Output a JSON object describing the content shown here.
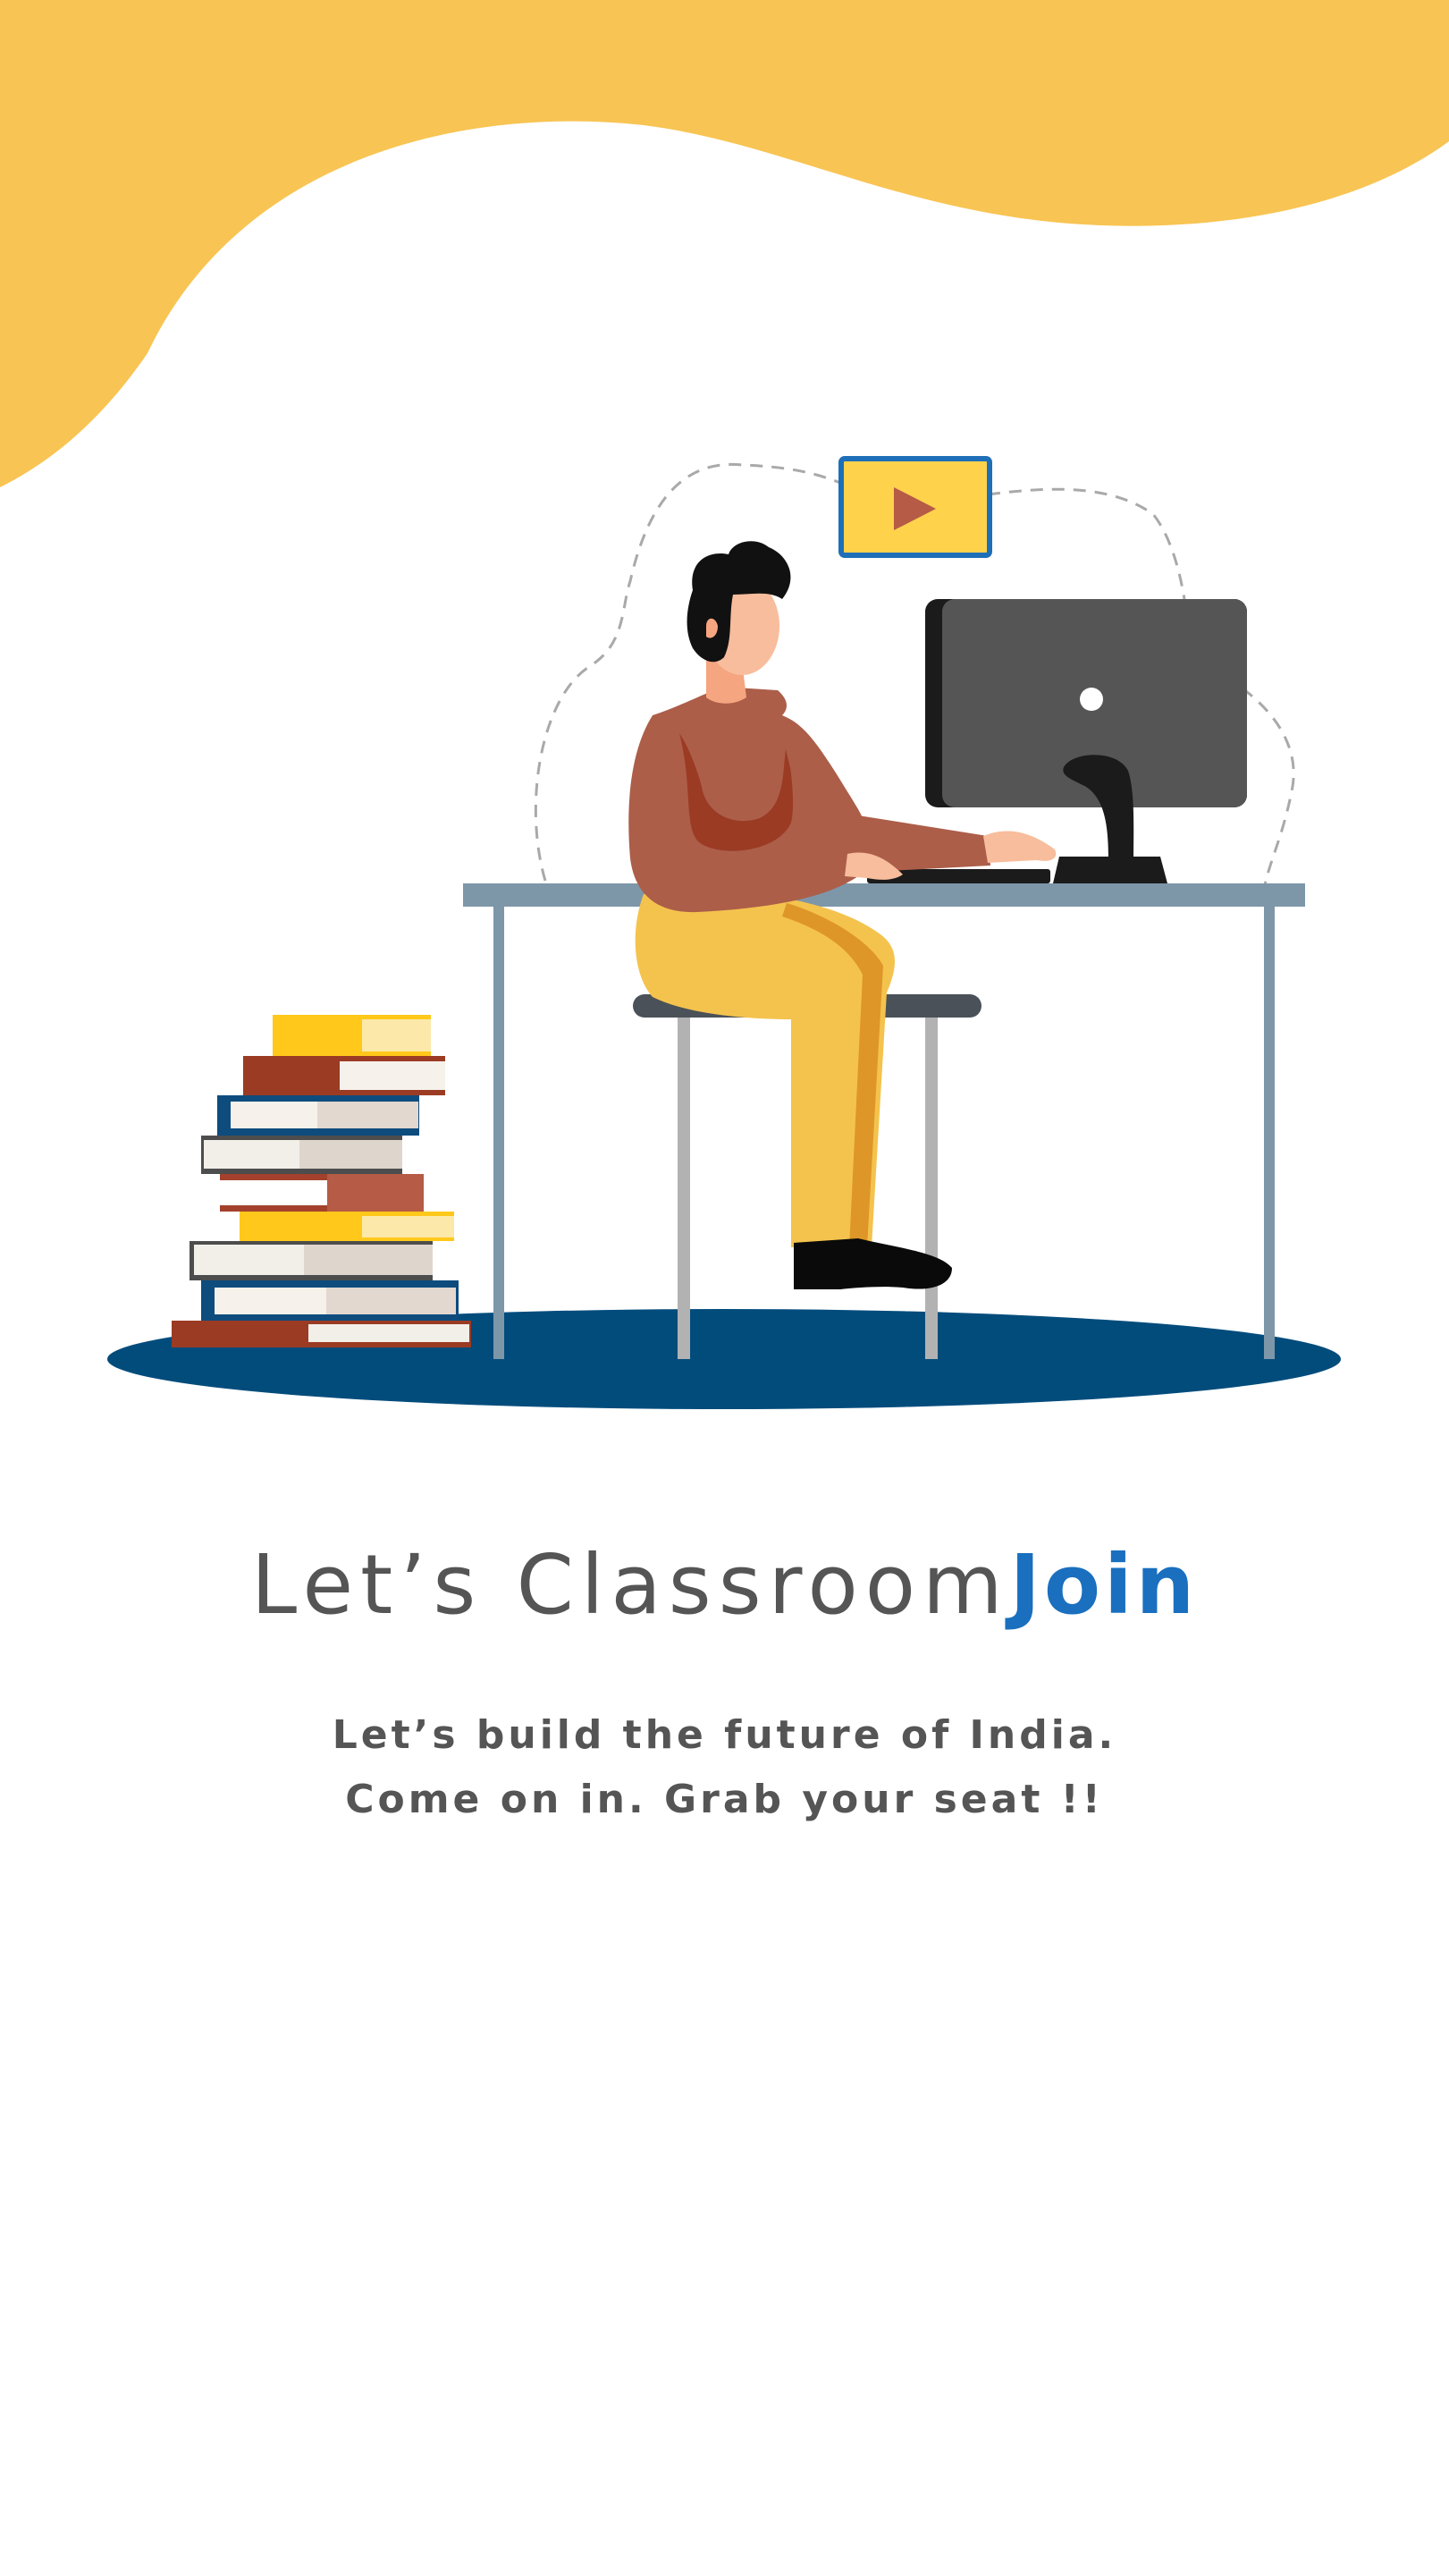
{
  "onboarding": {
    "title_prefix": "Let’s Classroom",
    "title_accent": "Join",
    "subtitle_line1": "Let’s build the future of India.",
    "subtitle_line2": "Come on in. Grab your seat !!"
  },
  "illustration": {
    "name": "student-at-computer-illustration",
    "icons": [
      "video-play-icon",
      "computer-monitor-icon",
      "book-stack-icon"
    ]
  },
  "colors": {
    "wave_yellow": "#F8C453",
    "accent_blue": "#1A6FBF",
    "text_gray": "#555555",
    "floor_navy": "#024C7C"
  }
}
